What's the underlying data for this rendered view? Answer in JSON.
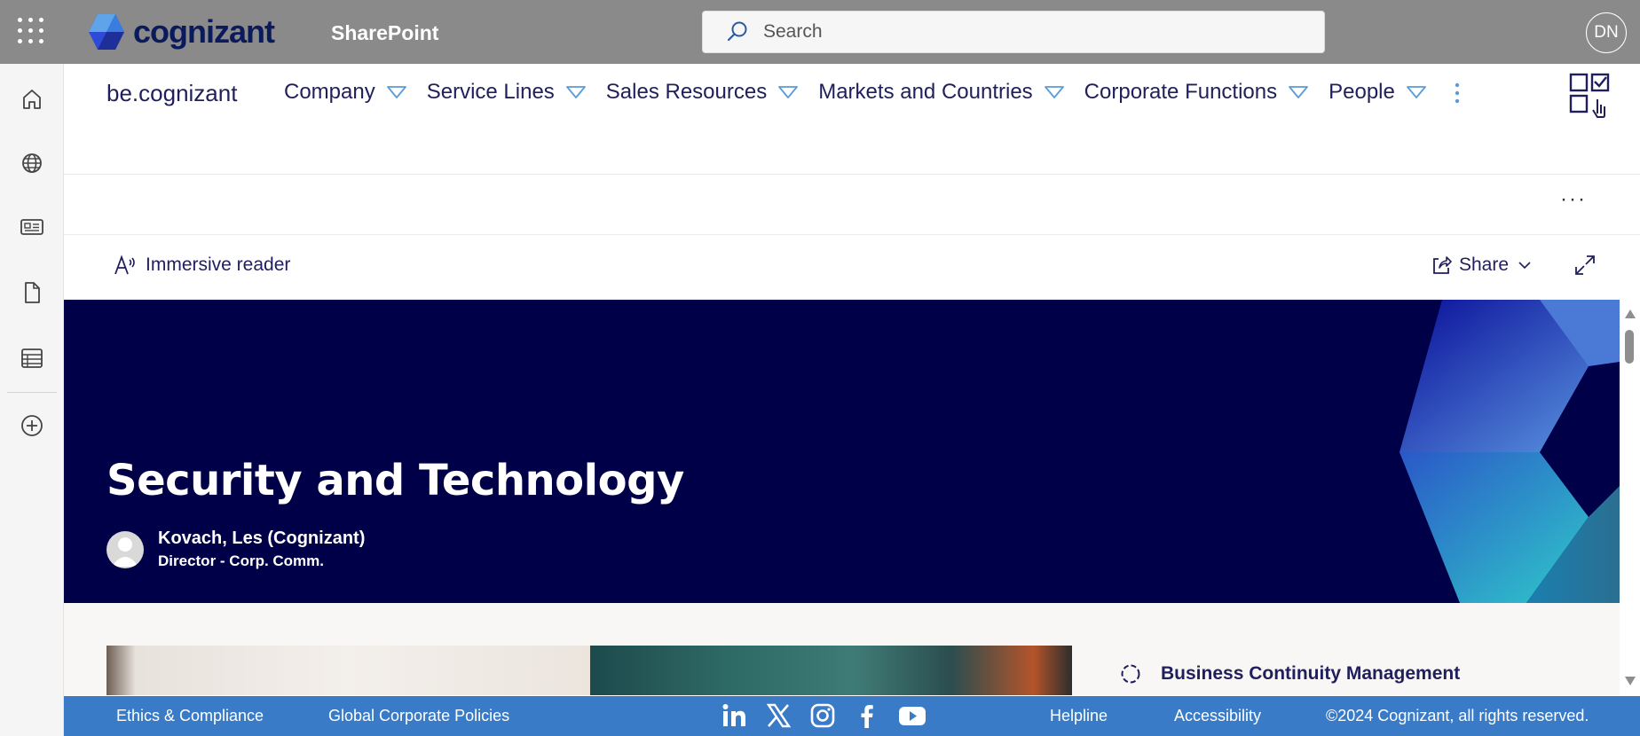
{
  "topbar": {
    "logo_text": "cognizant",
    "app_name": "SharePoint",
    "search_placeholder": "Search",
    "user_initials": "DN"
  },
  "hub_nav": {
    "site_title": "be.cognizant",
    "items": [
      {
        "label": "Company"
      },
      {
        "label": "Service Lines"
      },
      {
        "label": "Sales Resources"
      },
      {
        "label": "Markets and Countries"
      },
      {
        "label": "Corporate Functions"
      },
      {
        "label": "People"
      }
    ]
  },
  "command_bar": {
    "more_label": "···"
  },
  "action_bar": {
    "immersive_reader": "Immersive reader",
    "share": "Share"
  },
  "hero": {
    "title": "Security and Technology",
    "author_name": "Kovach, Les (Cognizant)",
    "author_role": "Director - Corp. Comm."
  },
  "content": {
    "quick_link": "Business Continuity Management"
  },
  "footer": {
    "ethics": "Ethics & Compliance",
    "policies": "Global Corporate Policies",
    "helpline": "Helpline",
    "accessibility": "Accessibility",
    "copyright": "©2024 Cognizant, all rights reserved."
  },
  "colors": {
    "topbar": "#8a8a8a",
    "brand_navy": "#000048",
    "footer_blue": "#3a7bc8",
    "nav_chevron": "#5c9bd6"
  }
}
